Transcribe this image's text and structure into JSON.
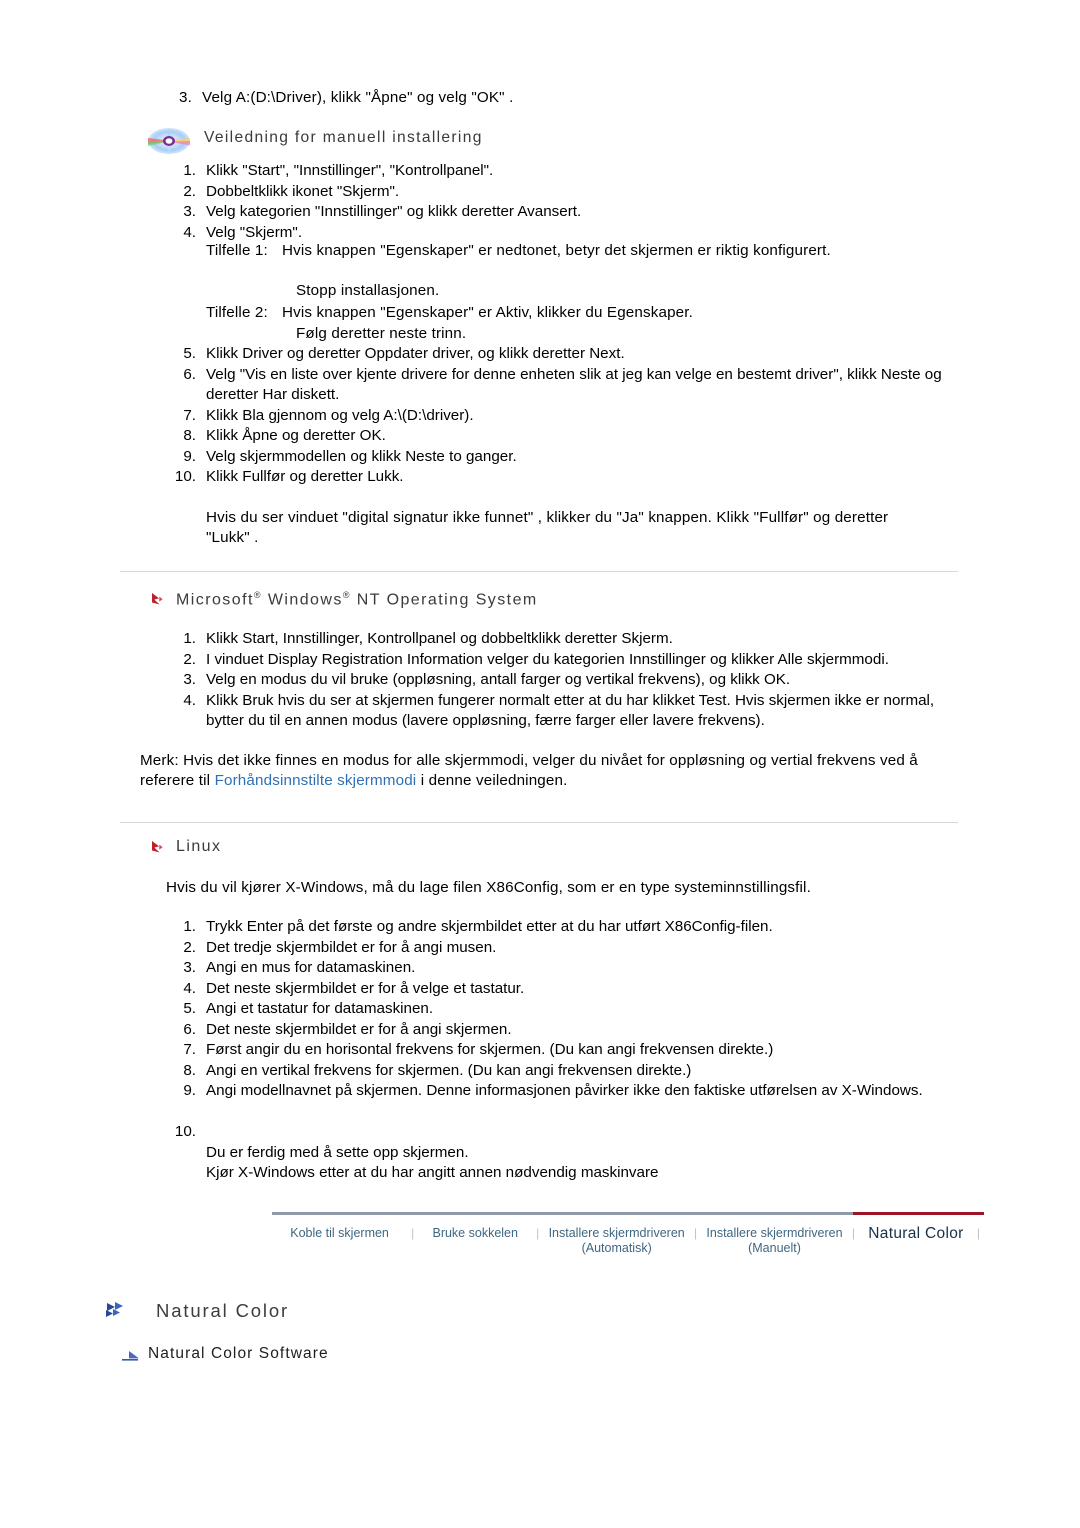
{
  "top_step": {
    "num": "3.",
    "text": "Velg A:(D:\\Driver), klikk \"Åpne\" og velg \"OK\" ."
  },
  "manual_section": {
    "icon": "cd-disc-icon",
    "title": "Veiledning for manuell installering",
    "steps": [
      {
        "num": "1.",
        "text": "Klikk \"Start\", \"Innstillinger\", \"Kontrollpanel\"."
      },
      {
        "num": "2.",
        "text": "Dobbeltklikk ikonet \"Skjerm\"."
      },
      {
        "num": "3.",
        "text": "Velg kategorien \"Innstillinger\" og klikk deretter Avansert."
      },
      {
        "num": "4.",
        "text": "Velg \"Skjerm\"."
      }
    ],
    "case1_label": "Tilfelle 1:",
    "case1_text": "Hvis knappen \"Egenskaper\" er nedtonet, betyr det skjermen er riktig konfigurert.",
    "case1_stop": "Stopp installasjonen.",
    "case2_label": "Tilfelle 2:",
    "case2_text": "Hvis knappen \"Egenskaper\" er Aktiv, klikker du Egenskaper.",
    "case2_follow": "Følg deretter neste trinn.",
    "steps_cont": [
      {
        "num": "5.",
        "text": "Klikk Driver og deretter Oppdater driver, og klikk deretter Next."
      },
      {
        "num": "6.",
        "text": "Velg \"Vis en liste over kjente drivere for denne enheten slik at jeg kan velge en bestemt driver\", klikk Neste og deretter Har diskett."
      },
      {
        "num": "7.",
        "text": "Klikk Bla gjennom og velg A:\\(D:\\driver)."
      },
      {
        "num": "8.",
        "text": "Klikk Åpne og deretter OK."
      },
      {
        "num": "9.",
        "text": "Velg skjermmodellen og klikk Neste to ganger."
      },
      {
        "num": "10.",
        "text": "Klikk Fullfør og deretter Lukk."
      }
    ],
    "closing": "Hvis du ser vinduet \"digital signatur ikke funnet\" , klikker du \"Ja\" knappen. Klikk \"Fullfør\" og deretter \"Lukk\" ."
  },
  "nt_section": {
    "bullet": "red-arrow-bullet-icon",
    "title_part1": "Microsoft",
    "title_reg1": "®",
    "title_part2": " Windows",
    "title_reg2": "®",
    "title_part3": " NT Operating System",
    "steps": [
      {
        "num": "1.",
        "text": "Klikk Start, Innstillinger, Kontrollpanel og dobbeltklikk deretter Skjerm."
      },
      {
        "num": "2.",
        "text": "I vinduet Display Registration Information velger du kategorien Innstillinger og klikker Alle skjermmodi."
      },
      {
        "num": "3.",
        "text": "Velg en modus du vil bruke (oppløsning, antall farger og vertikal frekvens), og klikk OK."
      },
      {
        "num": "4.",
        "text": "Klikk Bruk hvis du ser at skjermen fungerer normalt etter at du har klikket Test. Hvis skjermen ikke er normal, bytter du til en annen modus (lavere oppløsning, færre farger eller lavere frekvens)."
      }
    ],
    "note_prefix": "Merk:",
    "note_text_a": " Hvis det ikke finnes en modus for alle skjermmodi, velger du nivået for oppløsning og vertial frekvens ved å referere til ",
    "note_link": "Forhåndsinnstilte skjermmodi",
    "note_text_b": " i denne veiledningen."
  },
  "linux_section": {
    "bullet": "red-arrow-bullet-icon",
    "title": "Linux",
    "intro": "Hvis du vil kjører X-Windows, må du lage filen X86Config, som er en type systeminnstillingsfil.",
    "steps": [
      {
        "num": "1.",
        "text": "Trykk Enter på det første og andre skjermbildet etter at du har utført X86Config-filen."
      },
      {
        "num": "2.",
        "text": "Det tredje skjermbildet er for å angi musen."
      },
      {
        "num": "3.",
        "text": "Angi en mus for datamaskinen."
      },
      {
        "num": "4.",
        "text": "Det neste skjermbildet er for å velge et tastatur."
      },
      {
        "num": "5.",
        "text": "Angi et tastatur for datamaskinen."
      },
      {
        "num": "6.",
        "text": "Det neste skjermbildet er for å angi skjermen."
      },
      {
        "num": "7.",
        "text": "Først angir du en horisontal frekvens for skjermen. (Du kan angi frekvensen direkte.)"
      },
      {
        "num": "8.",
        "text": "Angi en vertikal frekvens for skjermen. (Du kan angi frekvensen direkte.)"
      },
      {
        "num": "9.",
        "text": "Angi modellnavnet på skjermen. Denne informasjonen påvirker ikke den faktiske utførelsen av X-Windows."
      },
      {
        "num": "10.",
        "text": "Du er ferdig med å sette opp skjermen.\nKjør X-Windows etter at du har angitt annen nødvendig maskinvare"
      }
    ]
  },
  "navbar": {
    "items": [
      {
        "label": "Koble til skjermen",
        "active": false
      },
      {
        "label": "Bruke sokkelen",
        "active": false
      },
      {
        "label": "Installere skjermdriveren\n(Automatisk)",
        "active": false
      },
      {
        "label": "Installere skjermdriveren\n(Manuelt)",
        "active": false
      },
      {
        "label": "Natural Color",
        "active": true
      }
    ],
    "separator": "|",
    "line_color_inactive": "#8f99a8",
    "line_color_active": "#9c1425"
  },
  "natural_color": {
    "heading_icon": "double-chevron-icon",
    "heading": "Natural Color",
    "sub_icon": "arrow-icon",
    "sub": "Natural Color Software"
  }
}
